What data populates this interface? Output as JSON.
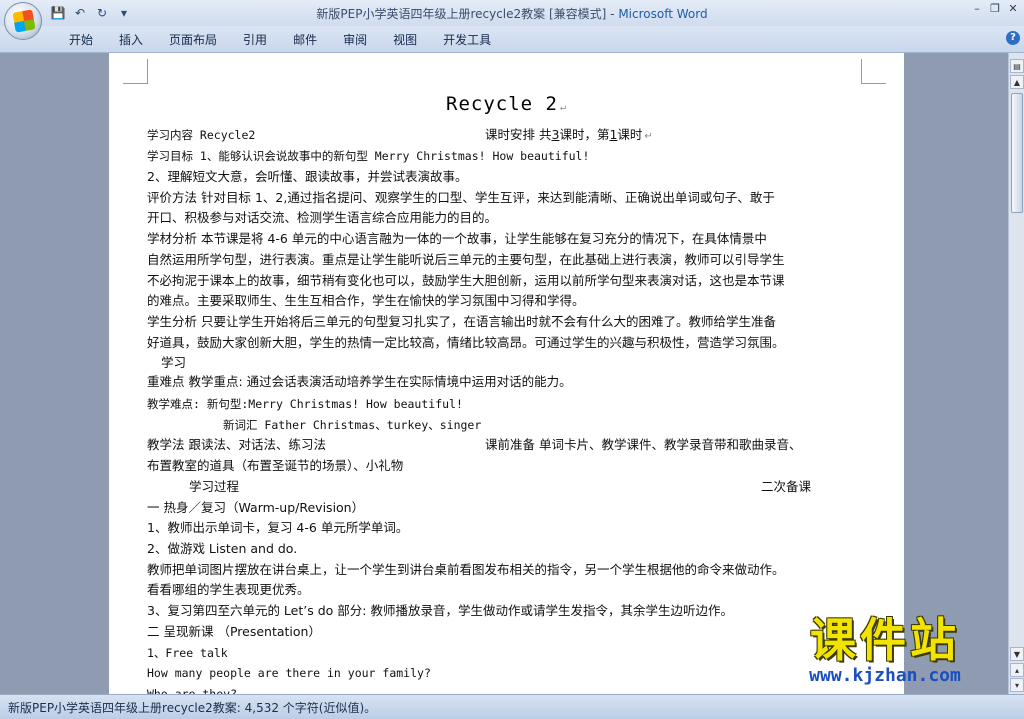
{
  "window": {
    "title_doc": "新版PEP小学英语四年级上册recycle2教案 [兼容模式]",
    "title_sep": " - ",
    "title_app": "Microsoft Word"
  },
  "qat": {
    "save": "💾",
    "undo": "↶",
    "redo": "↻",
    "more": "▾"
  },
  "ribbon": {
    "tabs": [
      "开始",
      "插入",
      "页面布局",
      "引用",
      "邮件",
      "审阅",
      "视图",
      "开发工具"
    ],
    "help": "?"
  },
  "window_controls": {
    "minimize": "–",
    "restore": "❐",
    "close": "✕"
  },
  "doc": {
    "title": "Recycle 2",
    "lines": [
      {
        "a": "学习内容  Recycle2",
        "b": "课时安排    共",
        "c": "3",
        "d": "课时，第",
        "e": "1",
        "f": "课时"
      },
      "学习目标  1、能够认识会说故事中的新句型 Merry Christmas! How beautiful!",
      "2、理解短文大意，会听懂、跟读故事，并尝试表演故事。",
      "评价方法  针对目标 1、2,通过指名提问、观察学生的口型、学生互评，来达到能清晰、正确说出单词或句子、敢于",
      "开口、积极参与对话交流、检测学生语言综合应用能力的目的。",
      "学材分析  本节课是将 4-6 单元的中心语言融为一体的一个故事，让学生能够在复习充分的情况下，在具体情景中",
      "自然运用所学句型，进行表演。重点是让学生能听说后三单元的主要句型，在此基础上进行表演，教师可以引导学生",
      "不必拘泥于课本上的故事，细节稍有变化也可以，鼓励学生大胆创新，运用以前所学句型来表演对话，这也是本节课",
      "的难点。主要采取师生、生生互相合作，学生在愉快的学习氛围中习得和学得。",
      "学生分析  只要让学生开始将后三单元的句型复习扎实了，在语言输出时就不会有什么大的困难了。教师给学生准备",
      "好道具，鼓励大家创新大胆，学生的热情一定比较高，情绪比较高昂。可通过学生的兴趣与积极性，营造学习氛围。",
      "学习",
      "重难点    教学重点: 通过会话表演活动培养学生在实际情境中运用对话的能力。",
      "教学难点: 新句型:Merry Christmas! How beautiful!",
      "新词汇 Father Christmas、turkey、singer",
      {
        "a": "教学法    跟读法、对话法、练习法",
        "b": "课前准备    单词卡片、教学课件、教学录音带和歌曲录音、"
      },
      "布置教室的道具（布置圣诞节的场景）、小礼物",
      {
        "a": "学习过程",
        "b": "二次备课"
      },
      "一 热身／复习（Warm-up/Revision）",
      "1、教师出示单词卡，复习 4-6 单元所学单词。",
      "2、做游戏 Listen and do.",
      "教师把单词图片摆放在讲台桌上，让一个学生到讲台桌前看图发布相关的指令，另一个学生根据他的命令来做动作。",
      "看看哪组的学生表现更优秀。",
      "3、复习第四至六单元的 Let’s do 部分: 教师播放录音，学生做动作或请学生发指令，其余学生边听边作。",
      "二 呈现新课 （Presentation）",
      "1、Free talk",
      "How many people are there in your family?",
      "Who are they?"
    ]
  },
  "status": {
    "text": "新版PEP小学英语四年级上册recycle2教案: 4,532 个字符(近似值)。"
  },
  "watermark": {
    "cn": "课件站",
    "url": "www.kjzhan.com"
  }
}
